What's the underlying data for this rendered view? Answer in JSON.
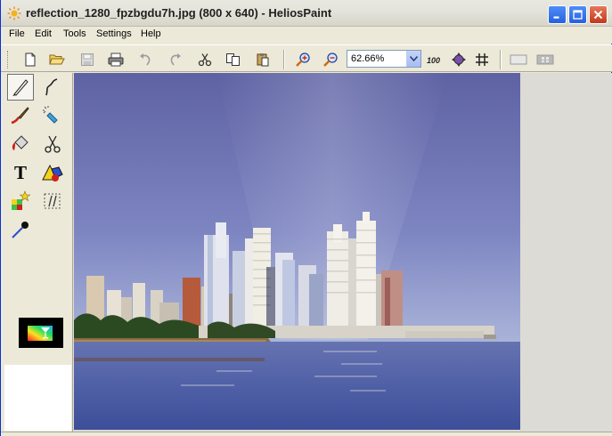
{
  "window": {
    "title": "reflection_1280_fpzbgdu7h.jpg (800 x 640) - HeliosPaint",
    "app_icon": "sun-icon"
  },
  "menu": {
    "items": [
      {
        "label": "File"
      },
      {
        "label": "Edit"
      },
      {
        "label": "Tools"
      },
      {
        "label": "Settings"
      },
      {
        "label": "Help"
      }
    ]
  },
  "toolbar": {
    "buttons": [
      "new-file-icon",
      "open-folder-icon",
      "save-icon",
      "print-icon",
      "undo-icon",
      "redo-icon",
      "cut-icon",
      "copy-icon",
      "paste-icon",
      "zoom-in-icon",
      "zoom-out-icon",
      "zoom-100-icon",
      "fit-window-icon",
      "grid-icon",
      "selection-rect-icon",
      "selection-grid-icon"
    ],
    "zoom_100_label": "100",
    "zoom": {
      "value": "62.66%"
    }
  },
  "tools": [
    "pencil-icon",
    "freehand-line-icon",
    "brush-icon",
    "spray-can-icon",
    "bucket-fill-icon",
    "scissors-select-icon",
    "text-tool-icon",
    "shapes-icon",
    "magic-wand-icon",
    "transform-icon",
    "color-picker-icon"
  ],
  "text_tool_label": "T",
  "colors": {
    "title_close": "#c3381b",
    "sky_top": "#7a80b8",
    "sky_bottom": "#a7b0d4",
    "water": "#5566a8"
  }
}
